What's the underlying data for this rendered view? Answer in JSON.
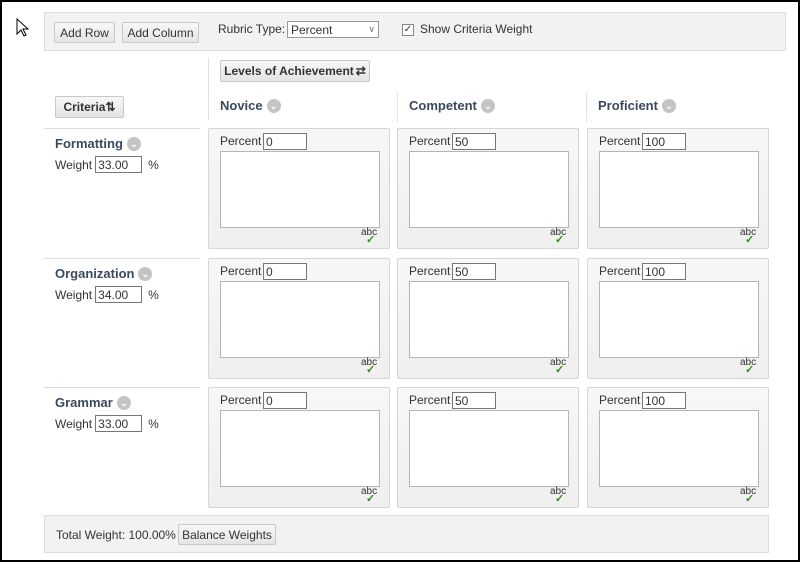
{
  "toolbar": {
    "add_row": "Add Row",
    "add_column": "Add Column",
    "rubric_type_label": "Rubric Type:",
    "rubric_type_value": "Percent",
    "show_weight_label": "Show Criteria Weight",
    "show_weight_checked": true
  },
  "levels_button": "Levels of Achievement",
  "criteria_button": "Criteria",
  "columns": [
    {
      "name": "Novice"
    },
    {
      "name": "Competent"
    },
    {
      "name": "Proficient"
    }
  ],
  "cell_label": "Percent",
  "weight_label": "Weight",
  "percent_sign": "%",
  "rows": [
    {
      "name": "Formatting",
      "weight": "33.00",
      "cells": [
        "0",
        "50",
        "100"
      ]
    },
    {
      "name": "Organization",
      "weight": "34.00",
      "cells": [
        "0",
        "50",
        "100"
      ]
    },
    {
      "name": "Grammar",
      "weight": "33.00",
      "cells": [
        "0",
        "50",
        "100"
      ]
    }
  ],
  "spellcheck_text": "abc",
  "footer": {
    "total_weight": "Total Weight: 100.00%",
    "balance_button": "Balance Weights"
  }
}
